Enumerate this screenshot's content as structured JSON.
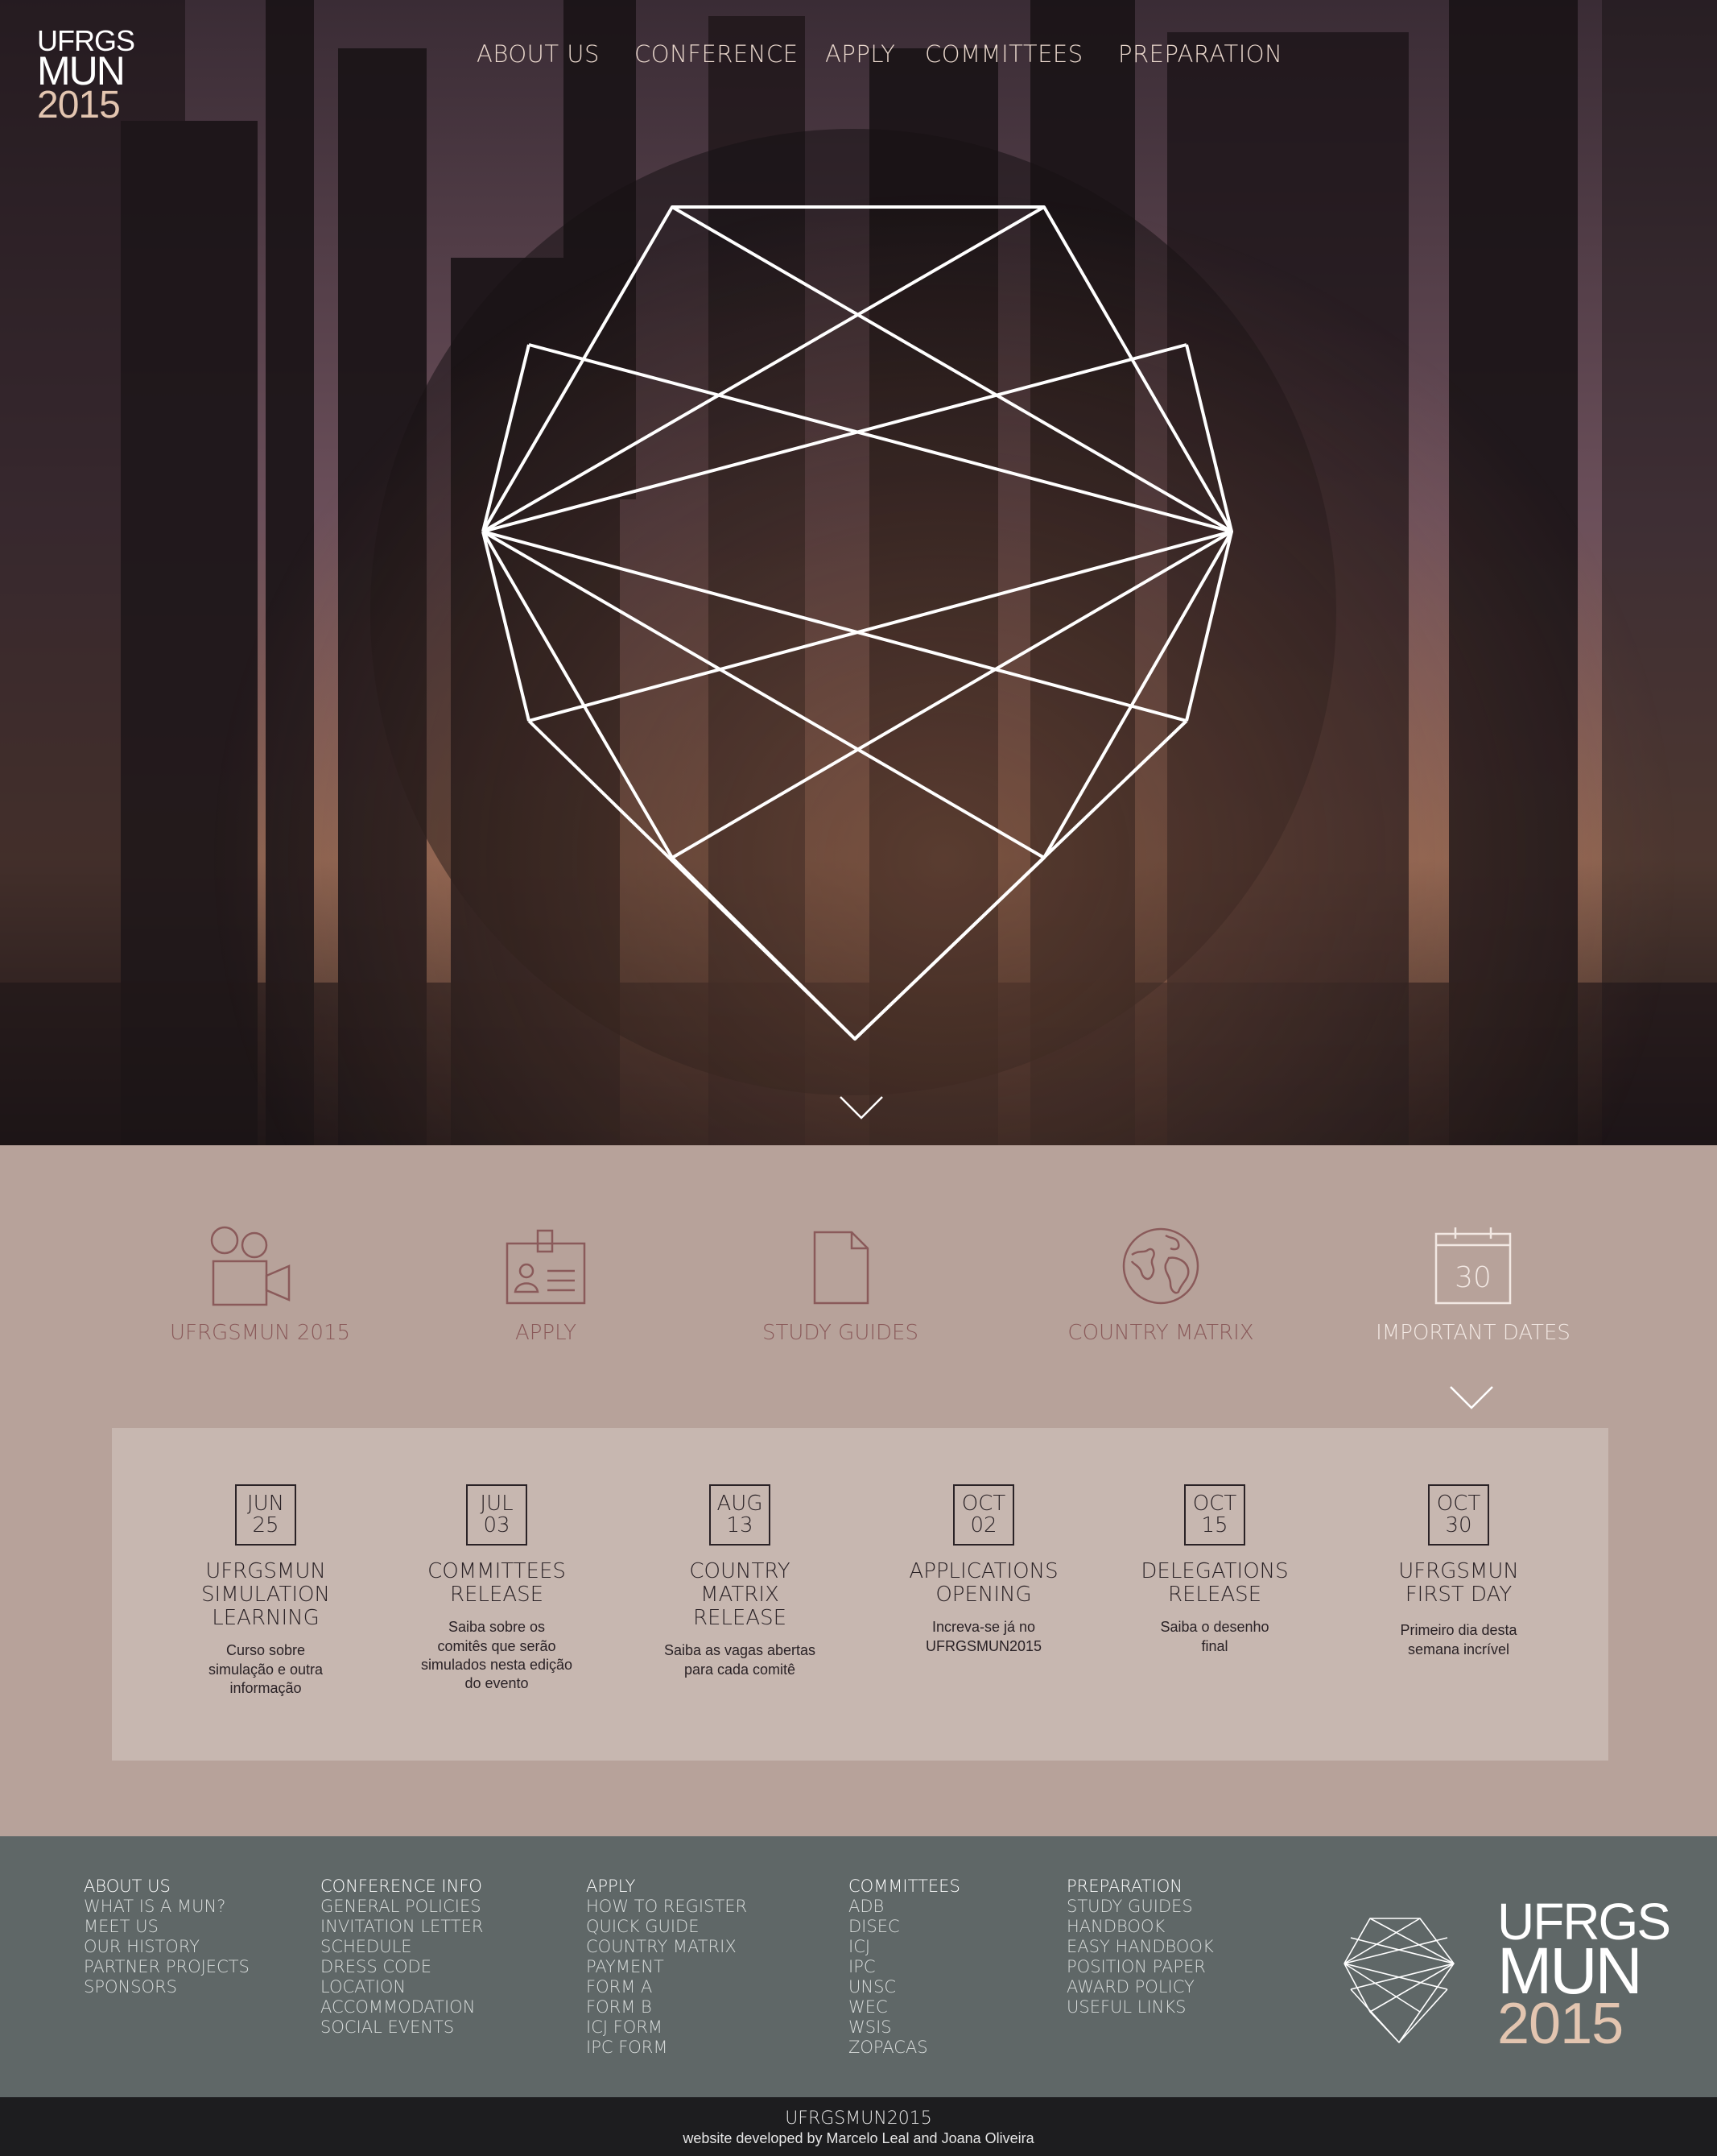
{
  "logo": {
    "line1": "UFRGS",
    "line2": "MUN",
    "line3": "2015"
  },
  "nav": [
    {
      "label": "ABOUT US"
    },
    {
      "label": "CONFERENCE"
    },
    {
      "label": "APPLY"
    },
    {
      "label": "COMMITTEES"
    },
    {
      "label": "PREPARATION"
    }
  ],
  "features": [
    {
      "label": "UFRGSMUN 2015",
      "icon": "camera-icon"
    },
    {
      "label": "APPLY",
      "icon": "id-card-icon"
    },
    {
      "label": "STUDY GUIDES",
      "icon": "document-icon"
    },
    {
      "label": "COUNTRY MATRIX",
      "icon": "globe-icon"
    },
    {
      "label": "IMPORTANT DATES",
      "icon": "calendar-icon",
      "calendar_day": "30"
    }
  ],
  "dates": [
    {
      "month": "JUN",
      "day": "25",
      "title_lines": [
        "UFRGSMUN",
        "SIMULATION",
        "LEARNING"
      ],
      "desc_lines": [
        "Curso sobre",
        "simulação e outra",
        "informação"
      ]
    },
    {
      "month": "JUL",
      "day": "03",
      "title_lines": [
        "COMMITTEES",
        "RELEASE"
      ],
      "desc_lines": [
        "Saiba sobre os",
        "comitês que serão",
        "simulados nesta edição",
        "do evento"
      ]
    },
    {
      "month": "AUG",
      "day": "13",
      "title_lines": [
        "COUNTRY",
        "MATRIX RELEASE"
      ],
      "desc_lines": [
        "Saiba as vagas abertas",
        "para cada comitê"
      ]
    },
    {
      "month": "OCT",
      "day": "02",
      "title_lines": [
        "APPLICATIONS",
        "OPENING"
      ],
      "desc_lines": [
        "Increva-se já no",
        "UFRGSMUN2015"
      ]
    },
    {
      "month": "OCT",
      "day": "15",
      "title_lines": [
        "DELEGATIONS",
        "RELEASE"
      ],
      "desc_lines": [
        "Saiba o desenho",
        "final"
      ]
    },
    {
      "month": "OCT",
      "day": "30",
      "title_lines": [
        "UFRGSMUN",
        "FIRST DAY"
      ],
      "desc_lines": [
        "Primeiro dia desta",
        "semana incrível"
      ]
    }
  ],
  "footer": {
    "columns": [
      {
        "head": "ABOUT US",
        "links": [
          "WHAT IS A MUN?",
          "MEET US",
          "OUR HISTORY",
          "PARTNER PROJECTS",
          "SPONSORS"
        ]
      },
      {
        "head": "CONFERENCE INFO",
        "links": [
          "GENERAL POLICIES",
          "INVITATION LETTER",
          "SCHEDULE",
          "DRESS CODE",
          "LOCATION",
          "ACCOMMODATION",
          "SOCIAL EVENTS"
        ]
      },
      {
        "head": "APPLY",
        "links": [
          "HOW TO REGISTER",
          "QUICK GUIDE",
          "COUNTRY MATRIX",
          "PAYMENT",
          "FORM A",
          "FORM B",
          "ICJ FORM",
          "IPC FORM"
        ]
      },
      {
        "head": "COMMITTEES",
        "links": [
          "ADB",
          "DISEC",
          "ICJ",
          "IPC",
          "UNSC",
          "WEC",
          "WSIS",
          "ZOPACAS"
        ]
      },
      {
        "head": "PREPARATION",
        "links": [
          "STUDY GUIDES",
          "HANDBOOK",
          "EASY HANDBOOK",
          "POSITION PAPER",
          "AWARD POLICY",
          "USEFUL LINKS"
        ]
      }
    ],
    "logo": {
      "line1": "UFRGS",
      "line2": "MUN",
      "line3": "2015"
    }
  },
  "bottom": {
    "title": "UFRGSMUN2015",
    "credit": "website developed by Marcelo Leal and Joana Oliveira"
  },
  "colors": {
    "accent": "#e3c5b0",
    "feature_bg": "#b7a29a",
    "panel_bg": "#c7b7b0",
    "footer_bg": "#5f6767",
    "bottom_bg": "#1d1d1f",
    "icon": "#8a5a5a"
  }
}
